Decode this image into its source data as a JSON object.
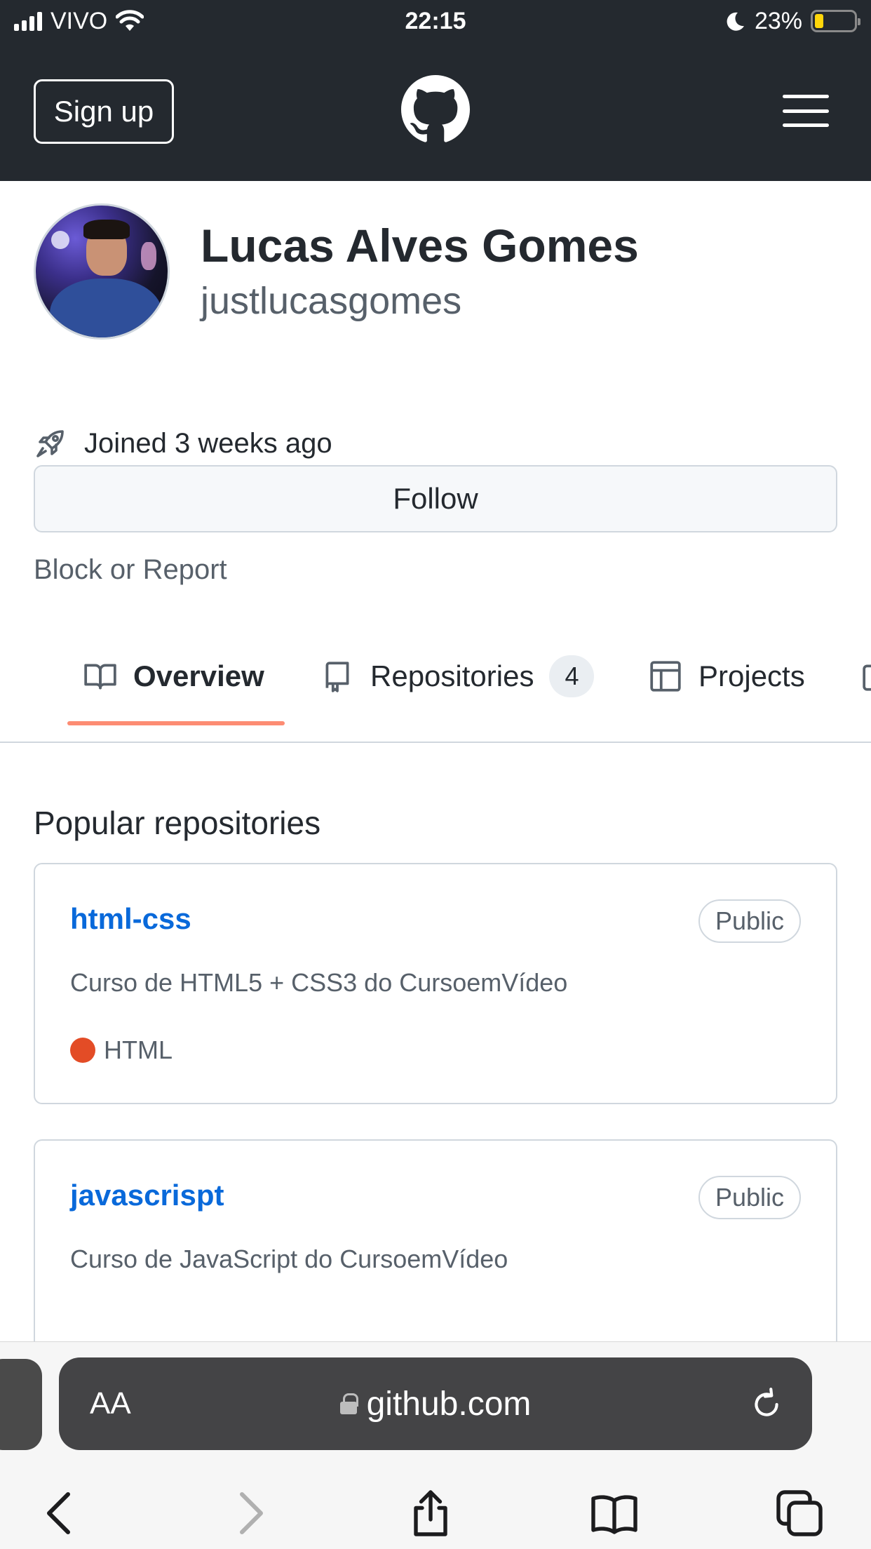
{
  "statusbar": {
    "carrier": "VIVO",
    "time": "22:15",
    "battery": "23%",
    "battery_level": 0.23
  },
  "header": {
    "signup_label": "Sign up",
    "logo_icon": "github-mark-icon",
    "menu_icon": "hamburger-menu-icon"
  },
  "profile": {
    "full_name": "Lucas Alves Gomes",
    "username": "justlucasgomes",
    "joined": "Joined 3 weeks ago",
    "follow_label": "Follow",
    "block_report": "Block or Report"
  },
  "tabs": [
    {
      "label": "Overview",
      "icon": "book-icon",
      "selected": true
    },
    {
      "label": "Repositories",
      "icon": "repo-icon",
      "count": "4"
    },
    {
      "label": "Projects",
      "icon": "table-icon"
    }
  ],
  "colors": {
    "header_bg": "#24292f",
    "link": "#0969da",
    "tab_underline": "#fd8c73",
    "html_language": "#e34c26"
  },
  "popular": {
    "title": "Popular repositories",
    "repos": [
      {
        "name": "html-css",
        "visibility": "Public",
        "description": "Curso de HTML5 + CSS3 do CursoemVídeo",
        "language": "HTML"
      },
      {
        "name": "javascrispt",
        "visibility": "Public",
        "description": "Curso de JavaScript do CursoemVídeo"
      }
    ]
  },
  "safari": {
    "text_size_label": "AA",
    "url": "github.com",
    "toolbar_icons": [
      "back-icon",
      "forward-icon",
      "share-icon",
      "bookmarks-icon",
      "tabs-icon"
    ]
  }
}
